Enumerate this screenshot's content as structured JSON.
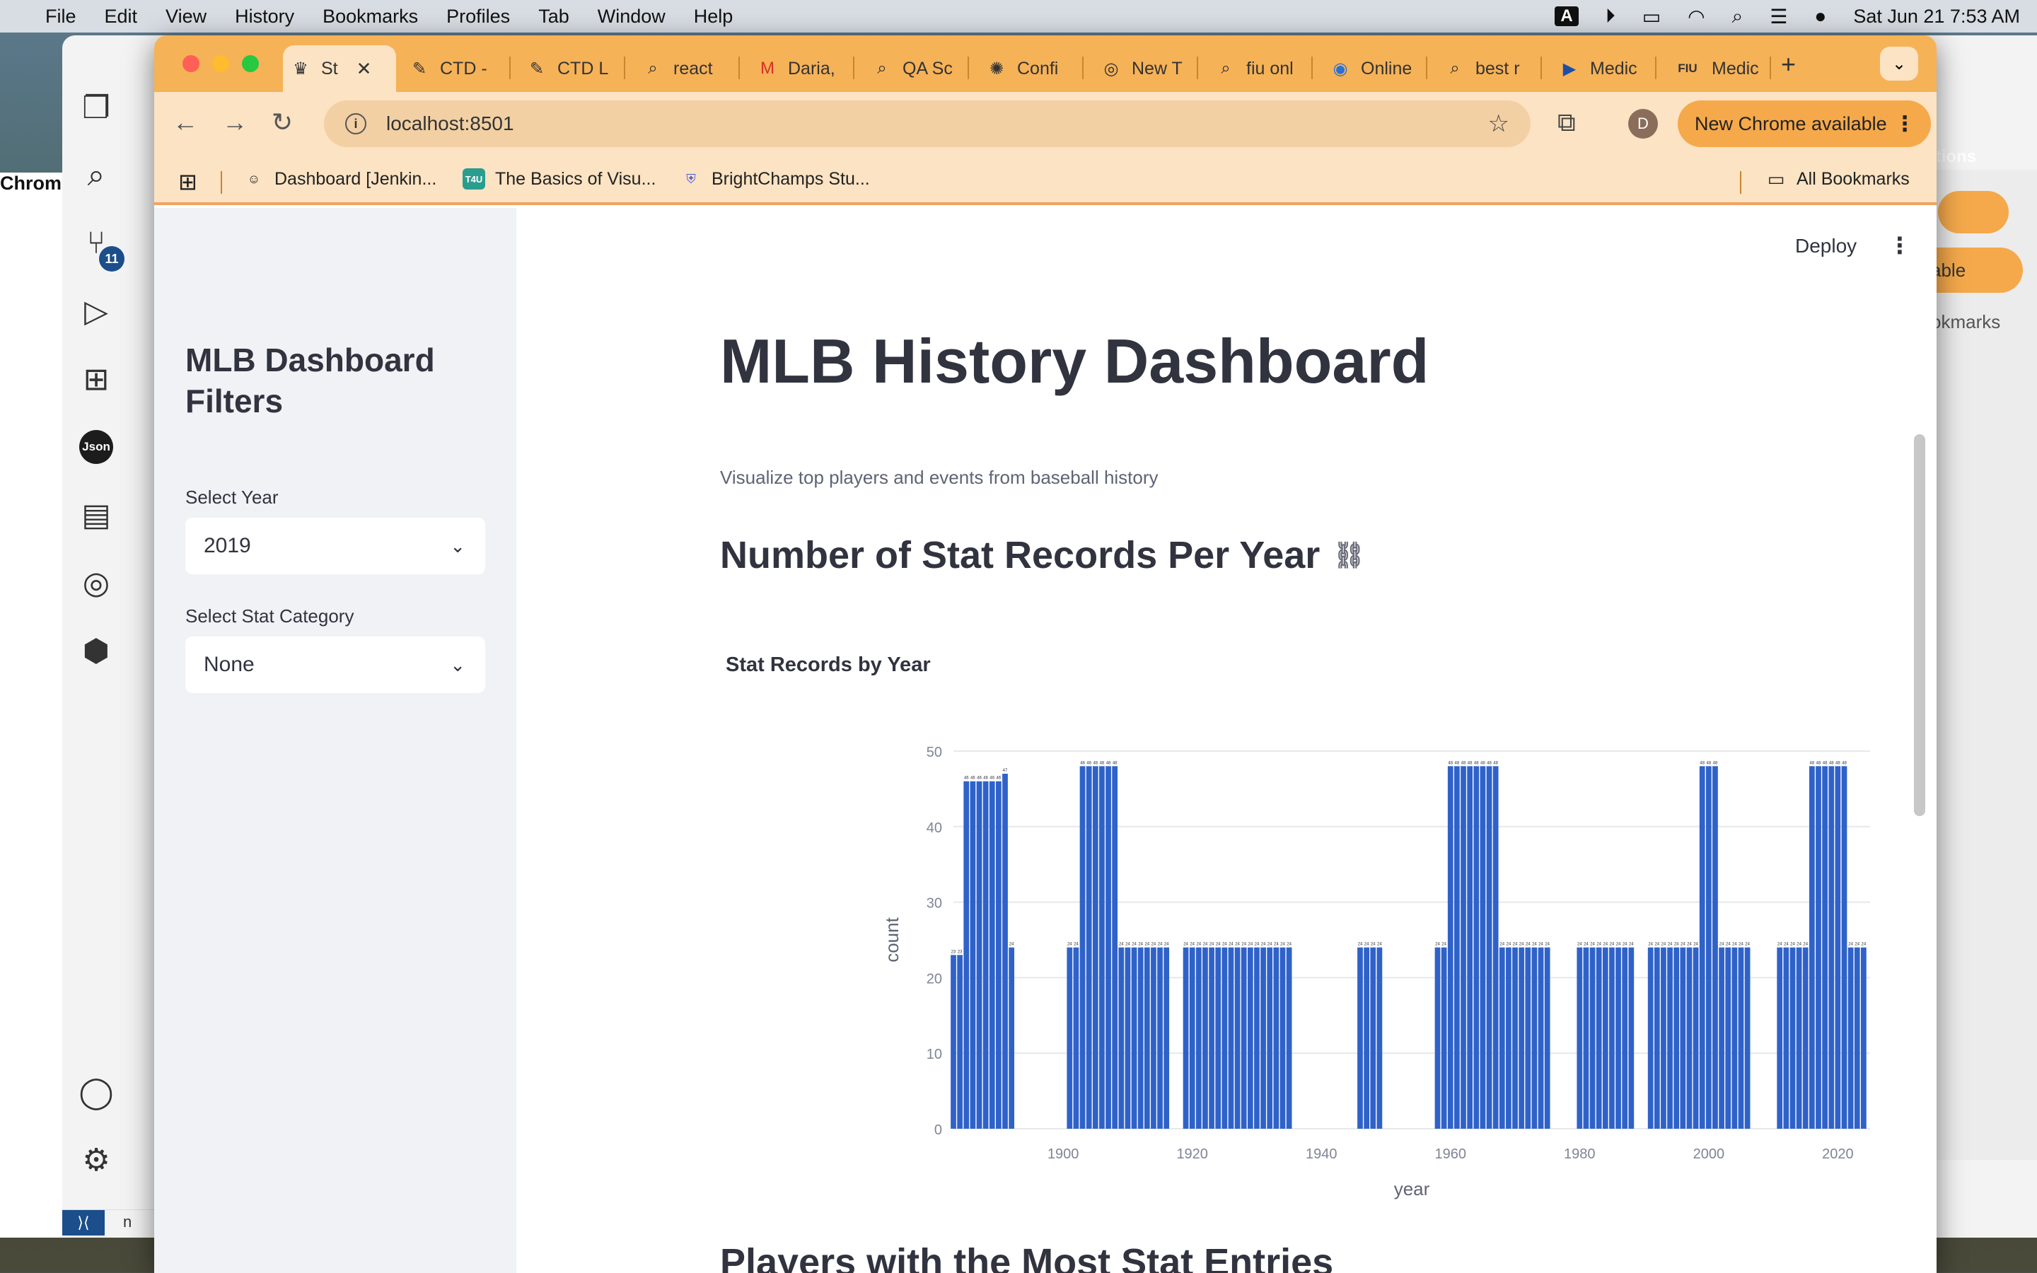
{
  "menubar": {
    "app": "Chrome",
    "items": [
      "File",
      "Edit",
      "View",
      "History",
      "Bookmarks",
      "Profiles",
      "Tab",
      "Window",
      "Help"
    ],
    "datetime": "Sat Jun 21  7:53 AM",
    "input_indicator": "A"
  },
  "vscode": {
    "badge": "11",
    "json_label": "Json",
    "peek_caption": "cations",
    "peek_button": "able",
    "peek_bookmarks": "okmarks",
    "status_branch": "n"
  },
  "tabs": [
    {
      "label": "St",
      "active": true
    },
    {
      "label": "CTD -"
    },
    {
      "label": "CTD L"
    },
    {
      "label": "react"
    },
    {
      "label": "Daria,"
    },
    {
      "label": "QA Sc"
    },
    {
      "label": "Confi"
    },
    {
      "label": "New T"
    },
    {
      "label": "fiu onl"
    },
    {
      "label": "Online"
    },
    {
      "label": "best r"
    },
    {
      "label": "Medic"
    },
    {
      "label": "Medic"
    }
  ],
  "toolbar": {
    "url": "localhost:8501",
    "avatar_letter": "D",
    "update_label": "New Chrome available"
  },
  "bookmarks": {
    "items": [
      "Dashboard [Jenkin...",
      "The Basics of Visu...",
      "BrightChamps Stu..."
    ],
    "all_bookmarks": "All Bookmarks",
    "t4u_label": "T4U"
  },
  "sidebar": {
    "title": "MLB Dashboard Filters",
    "year_label": "Select Year",
    "year_value": "2019",
    "stat_label": "Select Stat Category",
    "stat_value": "None"
  },
  "main": {
    "deploy": "Deploy",
    "title": "MLB History Dashboard",
    "subtitle": "Visualize top players and events from baseball history",
    "section1": "Number of Stat Records Per Year",
    "section2": "Players with the Most Stat Entries"
  },
  "chart_data": {
    "type": "bar",
    "title": "Stat Records by Year",
    "xlabel": "year",
    "ylabel": "count",
    "ylim": [
      0,
      50
    ],
    "xlim": [
      1883,
      2025
    ],
    "yticks": [
      0,
      10,
      20,
      30,
      40,
      50
    ],
    "xticks": [
      1900,
      1920,
      1940,
      1960,
      1980,
      2000,
      2020
    ],
    "color": "#2f62c9",
    "grid": true,
    "x": [
      1883,
      1884,
      1885,
      1886,
      1887,
      1888,
      1889,
      1890,
      1891,
      1892,
      1901,
      1902,
      1903,
      1904,
      1905,
      1906,
      1907,
      1908,
      1909,
      1910,
      1911,
      1912,
      1913,
      1914,
      1915,
      1916,
      1919,
      1920,
      1921,
      1922,
      1923,
      1924,
      1925,
      1926,
      1927,
      1928,
      1929,
      1930,
      1931,
      1932,
      1933,
      1934,
      1935,
      1946,
      1947,
      1948,
      1949,
      1958,
      1959,
      1960,
      1961,
      1962,
      1963,
      1964,
      1965,
      1966,
      1967,
      1968,
      1969,
      1970,
      1971,
      1972,
      1973,
      1974,
      1975,
      1980,
      1981,
      1982,
      1983,
      1984,
      1985,
      1986,
      1987,
      1988,
      1991,
      1992,
      1993,
      1994,
      1995,
      1996,
      1997,
      1998,
      1999,
      2000,
      2001,
      2002,
      2003,
      2004,
      2005,
      2006,
      2011,
      2012,
      2013,
      2014,
      2015,
      2016,
      2017,
      2018,
      2019,
      2020,
      2021,
      2022,
      2023,
      2024
    ],
    "values": [
      23,
      23,
      46,
      46,
      46,
      46,
      46,
      46,
      47,
      24,
      24,
      24,
      48,
      48,
      48,
      48,
      48,
      48,
      24,
      24,
      24,
      24,
      24,
      24,
      24,
      24,
      24,
      24,
      24,
      24,
      24,
      24,
      24,
      24,
      24,
      24,
      24,
      24,
      24,
      24,
      24,
      24,
      24,
      24,
      24,
      24,
      24,
      24,
      24,
      48,
      48,
      48,
      48,
      48,
      48,
      48,
      48,
      24,
      24,
      24,
      24,
      24,
      24,
      24,
      24,
      24,
      24,
      24,
      24,
      24,
      24,
      24,
      24,
      24,
      24,
      24,
      24,
      24,
      24,
      24,
      24,
      24,
      48,
      48,
      48,
      24,
      24,
      24,
      24,
      24,
      24,
      24,
      24,
      24,
      24,
      48,
      48,
      48,
      48,
      48,
      48,
      24,
      24,
      24
    ]
  }
}
